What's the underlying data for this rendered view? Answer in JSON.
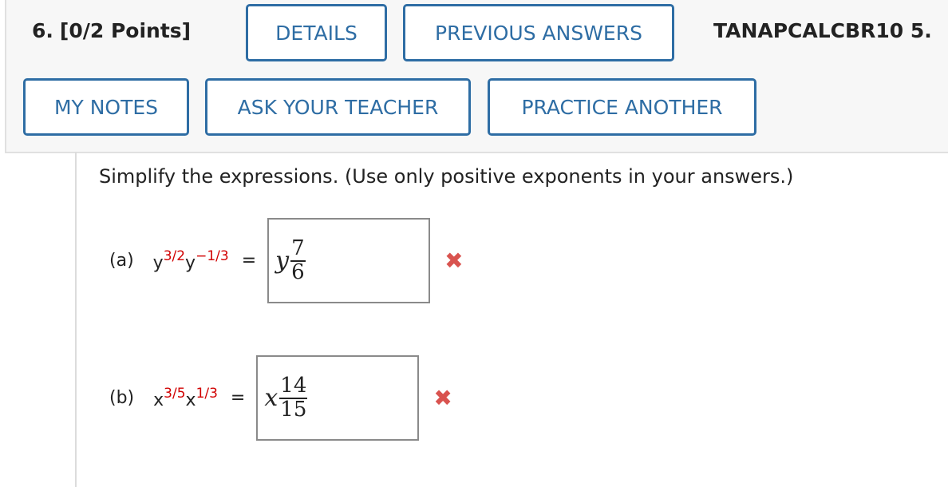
{
  "question": {
    "number": "6.",
    "points": "[0/2 Points]",
    "code": "TANAPCALCBR10 5."
  },
  "buttons": {
    "details": "DETAILS",
    "previous_answers": "PREVIOUS ANSWERS",
    "my_notes": "MY NOTES",
    "ask_teacher": "ASK YOUR TEACHER",
    "practice_another": "PRACTICE ANOTHER"
  },
  "instructions": "Simplify the expressions. (Use only positive exponents in your answers.)",
  "parts": {
    "a": {
      "label": "(a)",
      "base1": "y",
      "exp1": "3/2",
      "base2": "y",
      "exp2": "−1/3",
      "equals": "=",
      "answer_var": "y",
      "answer_num": "7",
      "answer_den": "6",
      "status": "incorrect",
      "status_icon": "✖"
    },
    "b": {
      "label": "(b)",
      "base1": "x",
      "exp1": "3/5",
      "base2": "x",
      "exp2": "1/3",
      "equals": "=",
      "answer_var": "x",
      "answer_num": "14",
      "answer_den": "15",
      "status": "incorrect",
      "status_icon": "✖"
    }
  },
  "colors": {
    "accent": "#2e6da4",
    "incorrect": "#d9534f",
    "exponent_red": "#d10000"
  }
}
